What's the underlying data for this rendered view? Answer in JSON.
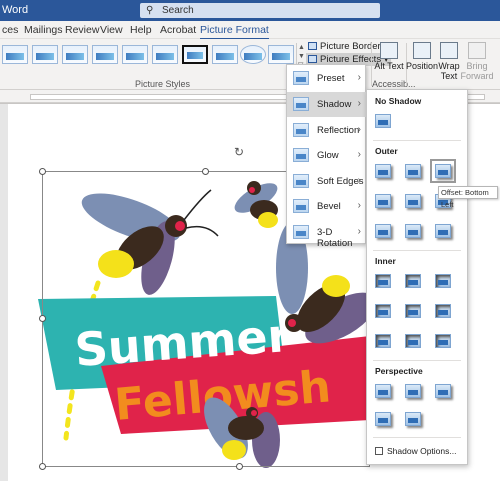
{
  "titlebar": {
    "app": "Word",
    "search_placeholder": "Search"
  },
  "tabs": [
    {
      "label": "ces"
    },
    {
      "label": "Mailings"
    },
    {
      "label": "Review"
    },
    {
      "label": "View"
    },
    {
      "label": "Help"
    },
    {
      "label": "Acrobat"
    },
    {
      "label": "Picture Format",
      "active": true
    }
  ],
  "ribbon": {
    "picture_border": "Picture Border",
    "picture_effects": "Picture Effects",
    "picture_styles_label": "Picture Styles",
    "accessibility_label": "Accessib...",
    "alt_text": "Alt Text",
    "position": "Position",
    "wrap_text": "Wrap Text",
    "bring_forward": "Bring Forward"
  },
  "effects_menu": [
    {
      "label": "Preset"
    },
    {
      "label": "Shadow",
      "highlighted": true
    },
    {
      "label": "Reflection"
    },
    {
      "label": "Glow"
    },
    {
      "label": "Soft Edges"
    },
    {
      "label": "Bevel"
    },
    {
      "label": "3-D Rotation"
    }
  ],
  "shadow_menu": {
    "no_shadow": "No Shadow",
    "outer": "Outer",
    "inner": "Inner",
    "perspective": "Perspective",
    "options": "Shadow Options...",
    "tooltip": "Offset: Bottom Left"
  },
  "artwork": {
    "line1": "Summer",
    "line2": "Fellowsh"
  },
  "colors": {
    "accent": "#2b579a",
    "teal": "#2db3b0",
    "red": "#e0234a",
    "orange": "#f28c1e"
  }
}
